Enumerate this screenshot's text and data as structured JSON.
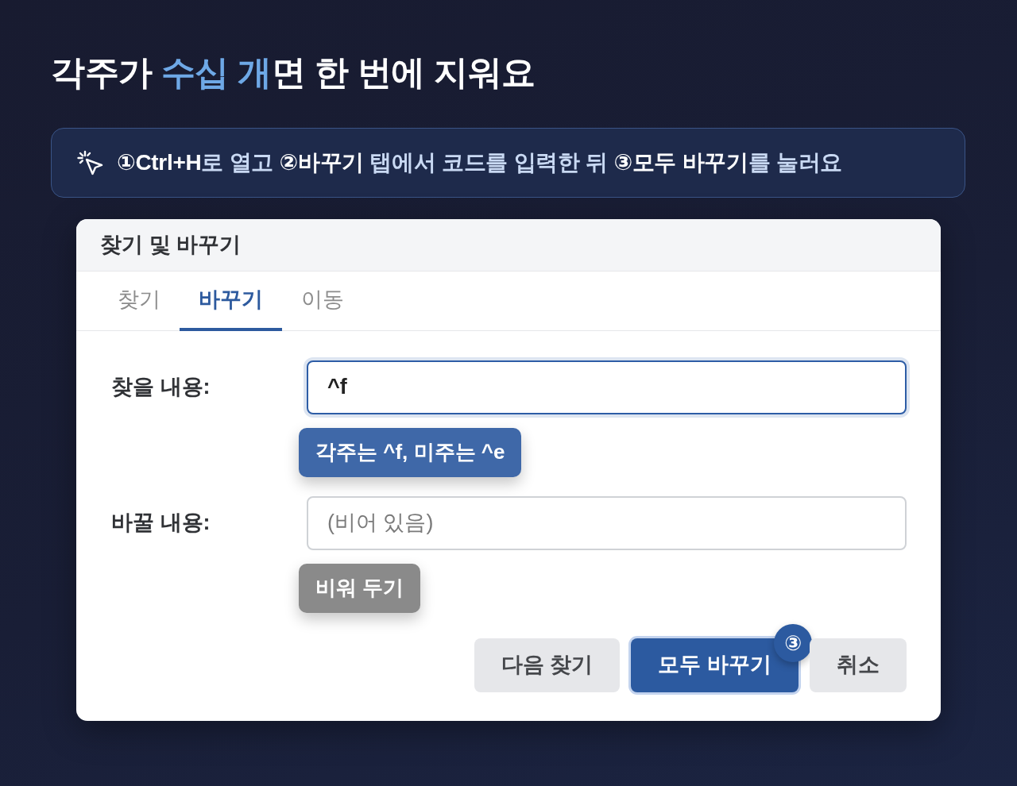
{
  "heading": {
    "text": "각주가 **수십 개**면 한 번에 지워요"
  },
  "instruction": {
    "text": "**①Ctrl+H**로 열고 **②바꾸기** 탭에서 코드를 입력한 뒤 **③모두 바꾸기**를 눌러요"
  },
  "dialog": {
    "title": "찾기 및 바꾸기",
    "tabs": [
      {
        "label": "찾기",
        "selected": false
      },
      {
        "label": "바꾸기",
        "selected": true
      },
      {
        "label": "이동",
        "selected": false
      }
    ],
    "fields": [
      {
        "label": "찾을 내용:",
        "value": "^f",
        "focused": true,
        "note": {
          "text": "각주는 ^f, 미주는 ^e",
          "color": "#3f68a8"
        }
      },
      {
        "label": "바꿀 내용:",
        "placeholder": "(비어 있음)",
        "focused": false,
        "note": {
          "text": "비워 두기",
          "color": "#8a8a8a"
        }
      }
    ],
    "buttons": [
      {
        "label": "다음 찾기",
        "primary": false
      },
      {
        "label": "모두 바꾸기",
        "primary": true,
        "badge": "③"
      },
      {
        "label": "취소",
        "primary": false
      }
    ]
  }
}
